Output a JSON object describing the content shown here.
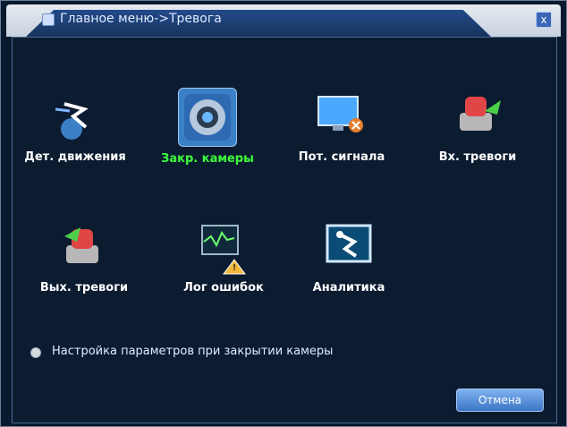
{
  "window": {
    "title": "Главное меню->Тревога",
    "close_label": "x"
  },
  "tiles": [
    {
      "label": "Дет. движения",
      "icon": "motion-icon"
    },
    {
      "label": "Закр. камеры",
      "icon": "camera-lens-icon"
    },
    {
      "label": "Пот. сигнала",
      "icon": "monitor-alert-icon"
    },
    {
      "label": "Вх. тревоги",
      "icon": "alarm-in-icon"
    },
    {
      "label": "Вых. тревоги",
      "icon": "alarm-out-icon"
    },
    {
      "label": "Лог ошибок",
      "icon": "error-log-icon"
    },
    {
      "label": "Аналитика",
      "icon": "analytics-icon"
    }
  ],
  "status": {
    "text": "Настройка параметров при закрытии камеры"
  },
  "buttons": {
    "cancel": "Отмена"
  },
  "colors": {
    "selected_label": "#3cff3c",
    "selected_tile_bg": "#3b7fc6"
  }
}
